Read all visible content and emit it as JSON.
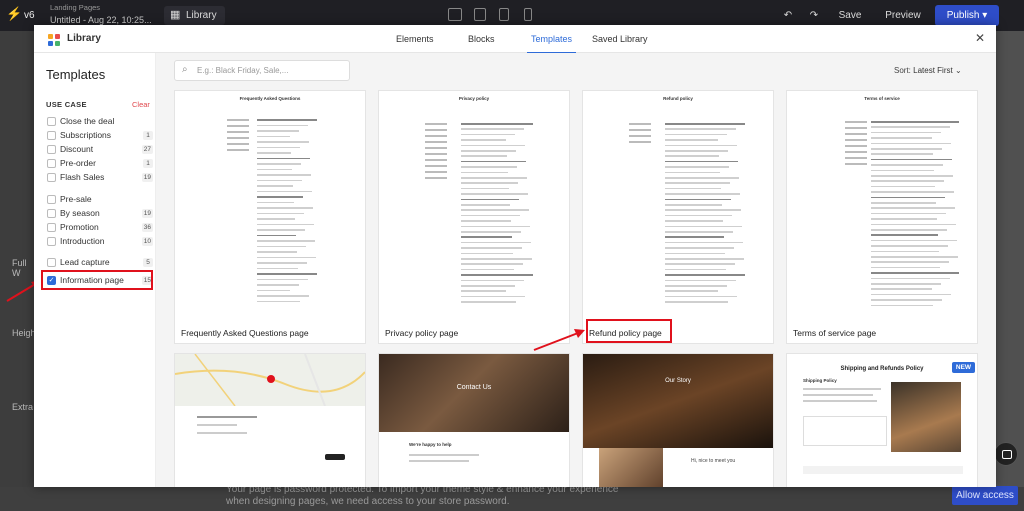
{
  "topbar": {
    "version": "v6",
    "breadcrumb": "Landing Pages",
    "page_title": "Untitled - Aug 22, 10:25...",
    "library_label": "Library",
    "save_label": "Save",
    "preview_label": "Preview",
    "publish_label": "Publish"
  },
  "modal": {
    "title": "Library",
    "tabs": [
      {
        "label": "Elements"
      },
      {
        "label": "Blocks"
      },
      {
        "label": "Templates"
      },
      {
        "label": "Saved Library"
      }
    ],
    "active_tab": "Templates"
  },
  "sidebar": {
    "heading": "Templates",
    "use_case_label": "USE CASE",
    "clear_label": "Clear",
    "groups": [
      {
        "label": "Close the deal",
        "items": [
          {
            "label": "Subscriptions",
            "count": "1"
          },
          {
            "label": "Discount",
            "count": "27"
          },
          {
            "label": "Pre-order",
            "count": "1"
          },
          {
            "label": "Flash Sales",
            "count": "19"
          }
        ]
      },
      {
        "label": "Pre-sale",
        "items": [
          {
            "label": "By season",
            "count": "19"
          },
          {
            "label": "Promotion",
            "count": "36"
          },
          {
            "label": "Introduction",
            "count": "10"
          }
        ]
      }
    ],
    "lead_capture": {
      "label": "Lead capture",
      "count": "5"
    },
    "information_page": {
      "label": "Information page",
      "count": "15",
      "checked": true
    }
  },
  "content": {
    "search_placeholder": "E.g.: Black Friday, Sale,...",
    "sort_label": "Sort:",
    "sort_value": "Latest First",
    "cards": [
      {
        "caption": "Frequently Asked Questions page",
        "doc_title": "Frequently Asked Questions"
      },
      {
        "caption": "Privacy policy page",
        "doc_title": "Privacy policy"
      },
      {
        "caption": "Refund policy page",
        "doc_title": "Refund policy"
      },
      {
        "caption": "Terms of service page",
        "doc_title": "Terms of service"
      }
    ],
    "row2": {
      "contact_heading": "Contact Us",
      "contact_sub": "We're happy to help",
      "story_heading": "Our Story",
      "story_sub": "Hi, nice to meet you",
      "shipping_heading": "Shipping and Refunds Policy",
      "shipping_sub": "Shipping Policy",
      "new_badge": "NEW"
    }
  },
  "background": {
    "password_msg_1": "Your page is password protected. To import your theme style & enhance your experience",
    "password_msg_2": "when designing pages, we need access to your store password.",
    "allow_label": "Allow access",
    "side_labels": [
      "Full W",
      "Heigh",
      "Extra"
    ]
  },
  "colors": {
    "accent": "#2e6bd8",
    "highlight": "#e0111c",
    "publish": "#2e4dc8"
  }
}
